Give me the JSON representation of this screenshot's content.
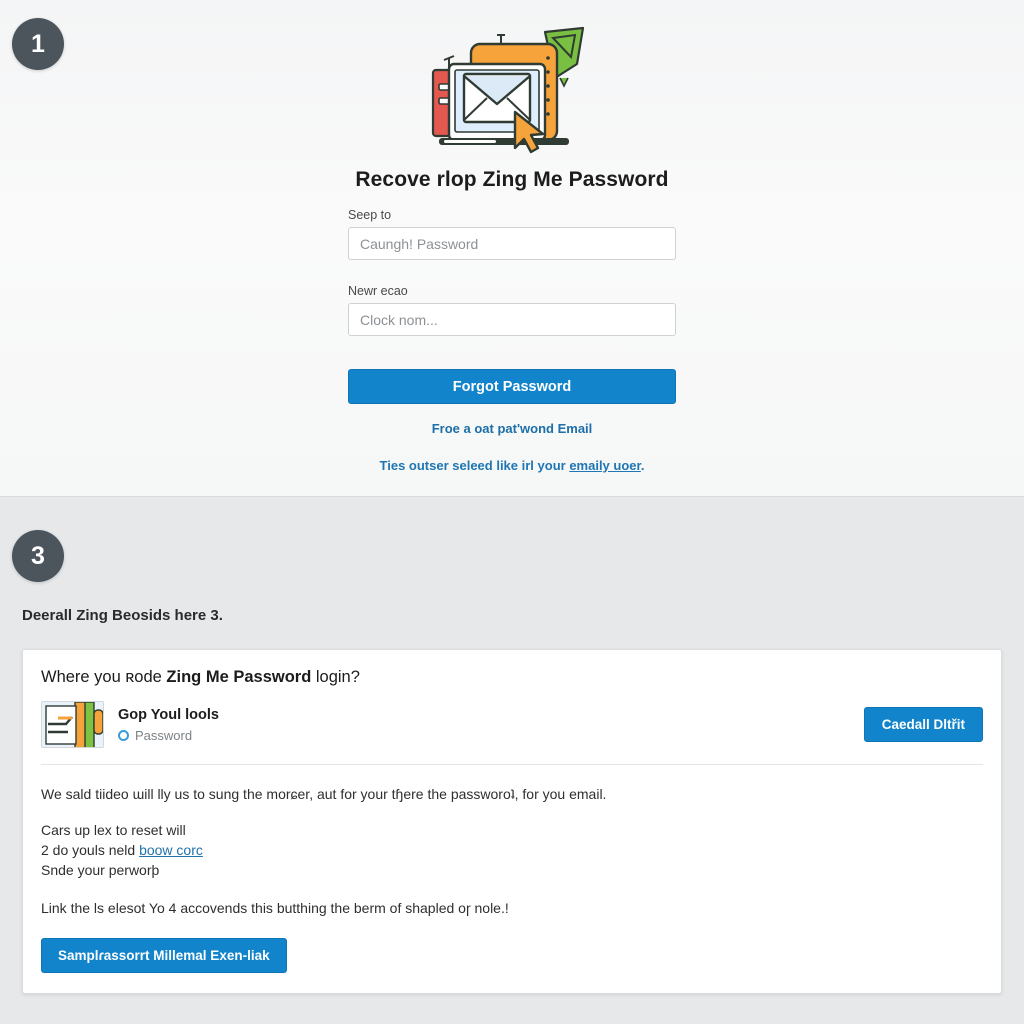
{
  "steps": {
    "first_badge": "1",
    "third_badge": "3"
  },
  "hero": {
    "illustration_name": "email-recovery-illustration",
    "title": "Recove rlop Zing Me Password"
  },
  "form": {
    "field_one": {
      "label": "Seep to",
      "placeholder": "Caungh! Password",
      "value": ""
    },
    "field_two": {
      "label": "Newr ecao",
      "placeholder": "Clock nom...",
      "value": ""
    },
    "submit_label": "Forgot Password",
    "secondary_link": "Froe a oat pat'wond Email",
    "note_prefix": "Ties outser seleed like irl your ",
    "note_link": "emaily uoer",
    "note_suffix": "."
  },
  "section": {
    "caption": "Deerall Zing Beosids here 3."
  },
  "card": {
    "question_prefix": "Where you ʀode ",
    "question_strong": "Zing Me Password",
    "question_suffix": " login?",
    "thumbnail_name": "source-thumbnail",
    "source_title": "Gop Youl lools",
    "source_sub": "Password",
    "action_label": "Caedall Dltřit",
    "paragraph": "We sald tiideo ɯill lly us to sung the morɕer, aut for your tɧere the passworoʇ, for you email.",
    "lines": [
      "Cars up lex to reset will",
      "2 do youls neld ",
      "Snde your perworþ"
    ],
    "line_link": "boow corc",
    "closing": "Link the ls elesot Yo 4 accovends this butthing the berm of shapled oɼ nole.!",
    "cta_label": "Samplɾassorrt Millemal Exen-liak"
  },
  "colors": {
    "accent_blue": "#1184cb",
    "badge_gray": "#4c545c",
    "link_blue": "#1f76b4",
    "panel_top_bg": "#f7f8f8",
    "panel_bottom_bg": "#e6e8ea",
    "card_bg": "#ffffff"
  }
}
